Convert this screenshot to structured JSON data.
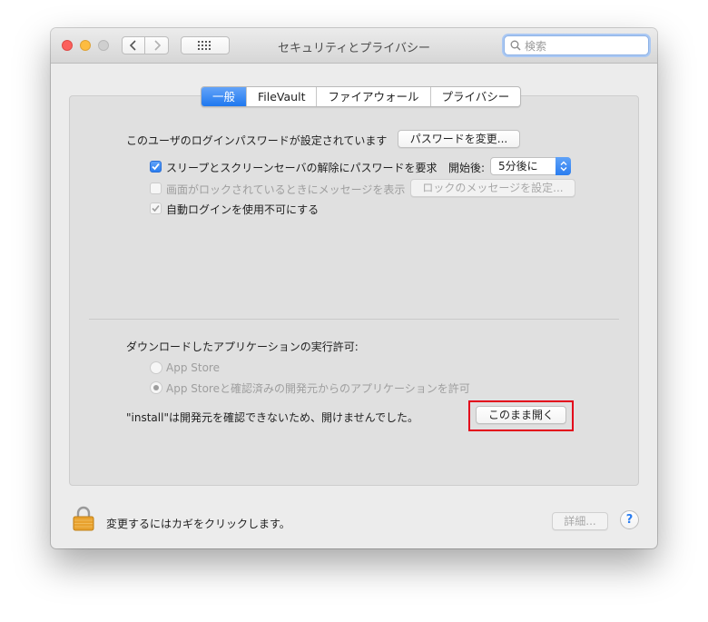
{
  "window": {
    "title": "セキュリティとプライバシー",
    "search_placeholder": "検索"
  },
  "tabs": [
    {
      "label": "一般",
      "active": true
    },
    {
      "label": "FileVault",
      "active": false
    },
    {
      "label": "ファイアウォール",
      "active": false
    },
    {
      "label": "プライバシー",
      "active": false
    }
  ],
  "general": {
    "password_set_text": "このユーザのログインパスワードが設定されています",
    "change_password_button": "パスワードを変更...",
    "require_password_label": "スリープとスクリーンセーバの解除にパスワードを要求",
    "require_password_checked": true,
    "after_label": "開始後:",
    "after_value": "5分後に",
    "show_message_label": "画面がロックされているときにメッセージを表示",
    "show_message_checked": false,
    "set_lock_message_button": "ロックのメッセージを設定...",
    "disable_autologin_label": "自動ログインを使用不可にする",
    "disable_autologin_checked": true
  },
  "downloads": {
    "heading": "ダウンロードしたアプリケーションの実行許可:",
    "option_app_store": "App Store",
    "option_identified": "App Storeと確認済みの開発元からのアプリケーションを許可",
    "selected": "option_identified",
    "blocked_message": "\"install\"は開発元を確認できないため、開けませんでした。",
    "open_anyway_button": "このまま開く"
  },
  "footer": {
    "lock_text": "変更するにはカギをクリックします。",
    "advanced_button": "詳細...",
    "help_button": "?"
  },
  "colors": {
    "accent": "#2a7df0",
    "highlight_box": "#e3001b",
    "lock": "#e8a22f"
  }
}
